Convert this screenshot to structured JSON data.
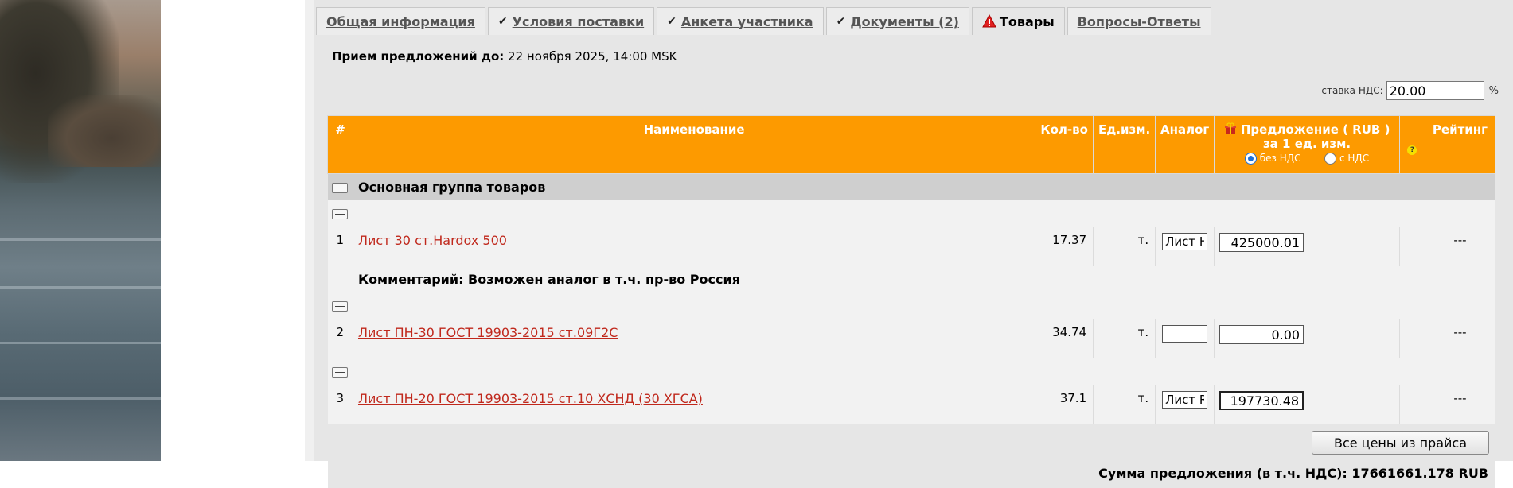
{
  "tabs": [
    {
      "label": "Общая информация",
      "check": false,
      "warn": false,
      "active": false
    },
    {
      "label": "Условия поставки",
      "check": true,
      "warn": false,
      "active": false
    },
    {
      "label": "Анкета участника",
      "check": true,
      "warn": false,
      "active": false
    },
    {
      "label": "Документы (2)",
      "check": true,
      "warn": false,
      "active": false
    },
    {
      "label": "Товары",
      "check": false,
      "warn": true,
      "active": true
    },
    {
      "label": "Вопросы-Ответы",
      "check": false,
      "warn": false,
      "active": false
    }
  ],
  "deadline": {
    "label": "Прием предложений до:",
    "value": "22 ноября 2025, 14:00 MSK"
  },
  "vat": {
    "label": "ставка НДС:",
    "value": "20.00",
    "unit": "%"
  },
  "table": {
    "headers": {
      "num": "#",
      "name": "Наименование",
      "qty": "Кол-во",
      "unit": "Ед.изм.",
      "analog": "Аналог",
      "offer_line1": "Предложение ( RUB )",
      "offer_line2": "за 1 ед. изм.",
      "radio_no_vat": "без НДС",
      "radio_with_vat": "с НДС",
      "help": "?",
      "rating": "Рейтинг"
    },
    "group_title": "Основная группа товаров",
    "items": [
      {
        "n": "1",
        "name": "Лист 30 ст.Hardox 500",
        "qty": "17.37",
        "unit": "т.",
        "analog": "Лист Н",
        "price": "425000.01",
        "rating": "---",
        "comment": "Комментарий: Возможен аналог в т.ч. пр-во Россия"
      },
      {
        "n": "2",
        "name": "Лист ПН-30 ГОСТ 19903-2015 ст.09Г2С",
        "qty": "34.74",
        "unit": "т.",
        "analog": "",
        "price": "0.00",
        "rating": "---"
      },
      {
        "n": "3",
        "name": "Лист ПН-20 ГОСТ 19903-2015 ст.10 ХСНД (30 ХГСА)",
        "qty": "37.1",
        "unit": "т.",
        "analog": "Лист R",
        "price": "197730.48",
        "rating": "---"
      }
    ],
    "button_label": "Все цены из прайса",
    "total": "Сумма предложения (в т.ч. НДС): 17661661.178 RUB"
  },
  "colors": {
    "header_orange": "#fd9a00",
    "link_red": "#c0281c"
  }
}
